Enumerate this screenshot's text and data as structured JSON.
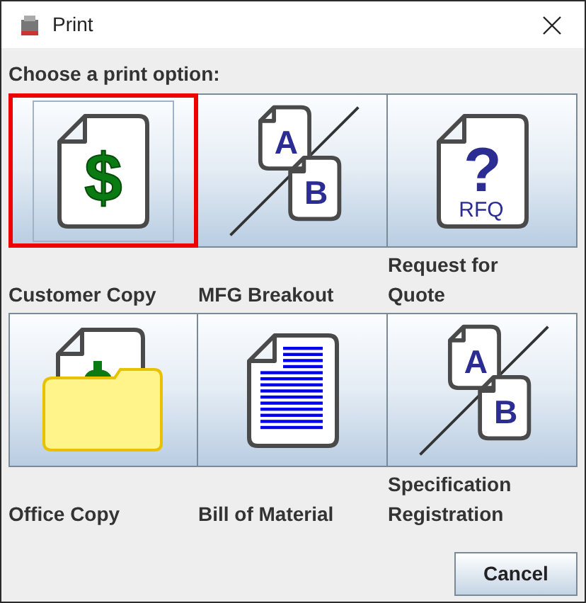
{
  "window": {
    "title": "Print"
  },
  "heading": "Choose a print option:",
  "options": [
    {
      "kind": "dollar",
      "glyphs": [
        "$"
      ],
      "label_lines": [
        "Customer Copy"
      ],
      "selected": true
    },
    {
      "kind": "ab",
      "glyphs": [
        "A",
        "B"
      ],
      "label_lines": [
        "MFG Breakout"
      ],
      "selected": false
    },
    {
      "kind": "rfq",
      "glyphs": [
        "?",
        "RFQ"
      ],
      "label_lines": [
        "Request for",
        "Quote"
      ],
      "selected": false
    },
    {
      "kind": "folder",
      "label_lines": [
        "Office Copy"
      ],
      "selected": false
    },
    {
      "kind": "list",
      "label_lines": [
        "Bill of Material"
      ],
      "selected": false
    },
    {
      "kind": "ab",
      "glyphs": [
        "A",
        "B"
      ],
      "label_lines": [
        "Specification",
        "Registration"
      ],
      "selected": false
    }
  ],
  "buttons": [
    "Cancel"
  ]
}
